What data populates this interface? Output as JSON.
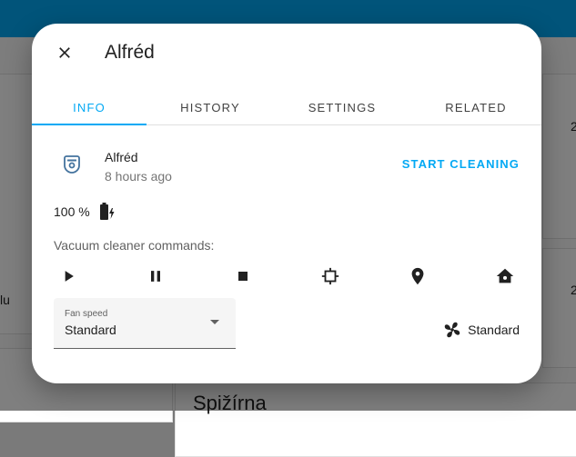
{
  "background": {
    "card_label_left": "lu",
    "card_label_right_1": "2",
    "card_label_right_2": "2",
    "bottom_title": "Spižírna"
  },
  "dialog": {
    "title": "Alfréd",
    "close_icon": "close-icon"
  },
  "tabs": [
    {
      "label": "INFO",
      "active": true
    },
    {
      "label": "HISTORY",
      "active": false
    },
    {
      "label": "SETTINGS",
      "active": false
    },
    {
      "label": "RELATED",
      "active": false
    }
  ],
  "entity": {
    "name": "Alfréd",
    "last_changed": "8 hours ago",
    "icon": "robot-vacuum-icon",
    "action_label": "START CLEANING"
  },
  "battery": {
    "level_text": "100 %",
    "icon": "battery-charging-icon"
  },
  "commands": {
    "label": "Vacuum cleaner commands:",
    "items": [
      "play-icon",
      "pause-icon",
      "stop-icon",
      "spot-clean-icon",
      "locate-icon",
      "return-home-icon"
    ]
  },
  "fan_speed": {
    "label": "Fan speed",
    "value": "Standard",
    "state_text": "Standard",
    "icon": "fan-icon"
  },
  "colors": {
    "accent": "#03a9f4",
    "header": "#03a9f4"
  }
}
